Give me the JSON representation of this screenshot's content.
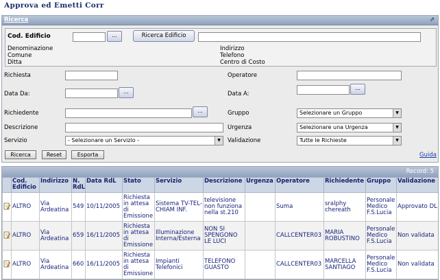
{
  "page": {
    "title": "Approva ed Emetti Corr"
  },
  "panel": {
    "title": "Ricerca"
  },
  "edificio": {
    "cod_label": "Cod. Edificio",
    "cod_value": "",
    "browse_label": "...",
    "search_button": "Ricerca Edificio",
    "search_value": "",
    "left_fields": [
      "Denominazione",
      "Comune",
      "Ditta"
    ],
    "right_fields": [
      "Indirizzo",
      "Telefono",
      "Centro di Costo"
    ]
  },
  "form": {
    "richiesta_label": "Richiesta",
    "operatore_label": "Operatore",
    "data_da_label": "Data Da:",
    "data_a_label": "Data A:",
    "richiedente_label": "Richiedente",
    "gruppo_label": "Gruppo",
    "descrizione_label": "Descrizione",
    "urgenza_label": "Urgenza",
    "servizio_label": "Servizio",
    "validazione_label": "Validazione",
    "browse_label": "...",
    "gruppo_value": "Selezionare un Gruppo",
    "urgenza_value": "Selezionare una Urgenza",
    "servizio_value": "- Selezionare un Servizio -",
    "validazione_value": "Tutte le Richieste"
  },
  "actions": {
    "ricerca": "Ricerca",
    "reset": "Reset",
    "esporta": "Esporta",
    "guida": "Guida"
  },
  "results": {
    "record_label": "Record: 5",
    "columns": [
      "",
      "Cod. Edificio",
      "Indirizzo",
      "N. RdL",
      "Data RdL",
      "Stato",
      "Servizio",
      "Descrizione",
      "Urgenza",
      "Operatore",
      "Richiedente",
      "Gruppo",
      "Validazione"
    ],
    "rows": [
      [
        "",
        "ALTRO",
        "Via Ardeatina",
        "549",
        "10/11/2005",
        "Richiesta in attesa di Emissione",
        "Sistema TV-TEL-CHIAM INF.",
        "televisione non funziona nella st.210",
        "",
        "Suma",
        "sralphy chereath",
        "Personale Medico F.S.Lucia",
        "Approvato DL"
      ],
      [
        "",
        "ALTRO",
        "Via Ardeatina",
        "659",
        "16/11/2005",
        "Richiesta in attesa di Emissione",
        "Illuminazione Interna/Esterna",
        "NON SI SPENGONO LE LUCI",
        "",
        "CALLCENTER03",
        "MARIA ROBUSTINO",
        "Personale Medico F.S.Lucia",
        "Non validata"
      ],
      [
        "",
        "ALTRO",
        "Via Ardeatina",
        "660",
        "16/11/2005",
        "Richiesta in attesa di Emissione",
        "Impianti Telefonici",
        "TELEFONO GUASTO",
        "",
        "CALLCENTER03",
        "MARCELLA SANTIAGO",
        "Personale Medico F.S.Lucia",
        "Non validata"
      ]
    ]
  },
  "colors": {
    "header_blue": "#1b2f6b",
    "bar": "#9aabc6",
    "link": "#1a3bb0"
  }
}
